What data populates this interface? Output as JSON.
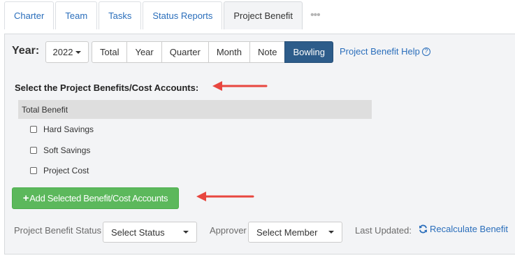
{
  "tabs": [
    {
      "label": "Charter",
      "active": false
    },
    {
      "label": "Team",
      "active": false
    },
    {
      "label": "Tasks",
      "active": false
    },
    {
      "label": "Status Reports",
      "active": false
    },
    {
      "label": "Project Benefit",
      "active": true
    }
  ],
  "tabs_more": "•••",
  "year": {
    "label": "Year:",
    "selected": "2022"
  },
  "view_buttons": [
    {
      "label": "Total",
      "active": false
    },
    {
      "label": "Year",
      "active": false
    },
    {
      "label": "Quarter",
      "active": false
    },
    {
      "label": "Month",
      "active": false
    },
    {
      "label": "Note",
      "active": false
    },
    {
      "label": "Bowling",
      "active": true
    }
  ],
  "help_link": {
    "label": "Project Benefit Help",
    "icon": "?"
  },
  "section_title": "Select the Project Benefits/Cost Accounts:",
  "total_benefit": "Total Benefit",
  "accounts": [
    "Hard Savings",
    "Soft Savings",
    "Project Cost"
  ],
  "add_button": {
    "icon": "+",
    "label": "Add Selected Benefit/Cost Accounts"
  },
  "footer": {
    "status_label": "Project Benefit Status",
    "status_select": "Select Status",
    "approver_label": "Approver",
    "approver_select": "Select Member",
    "updated_label": "Last Updated:",
    "recalc_label": "Recalculate Benefit"
  },
  "colors": {
    "link": "#2a6ebb",
    "active_button": "#2d5c8a",
    "add_button": "#5cb85c",
    "annotation_arrow": "#e8463f",
    "panel_bg": "#f3f4f6"
  }
}
